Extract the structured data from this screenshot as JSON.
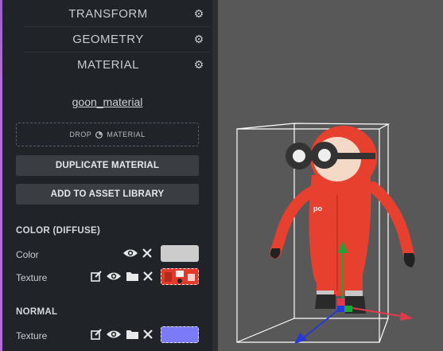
{
  "panel": {
    "headers": [
      {
        "label": "TRANSFORM",
        "icon": "transform-axes-icon"
      },
      {
        "label": "GEOMETRY",
        "icon": "cube-icon"
      },
      {
        "label": "MATERIAL",
        "icon": "material-sphere-icon"
      }
    ],
    "material_name": "goon_material",
    "drop_label_left": "DROP",
    "drop_label_right": "MATERIAL",
    "duplicate_label": "DUPLICATE MATERIAL",
    "add_library_label": "ADD TO ASSET LIBRARY",
    "color_section": {
      "title": "COLOR (DIFFUSE)",
      "color_label": "Color",
      "color_value": "#cccccc",
      "texture_label": "Texture"
    },
    "normal_section": {
      "title": "NORMAL",
      "texture_label": "Texture",
      "texture_color": "#7b7bfa"
    }
  },
  "colors": {
    "accent": "#b06ed6",
    "panel_bg": "#202327",
    "viewport_bg": "#585858",
    "character_red": "#e8402f"
  }
}
